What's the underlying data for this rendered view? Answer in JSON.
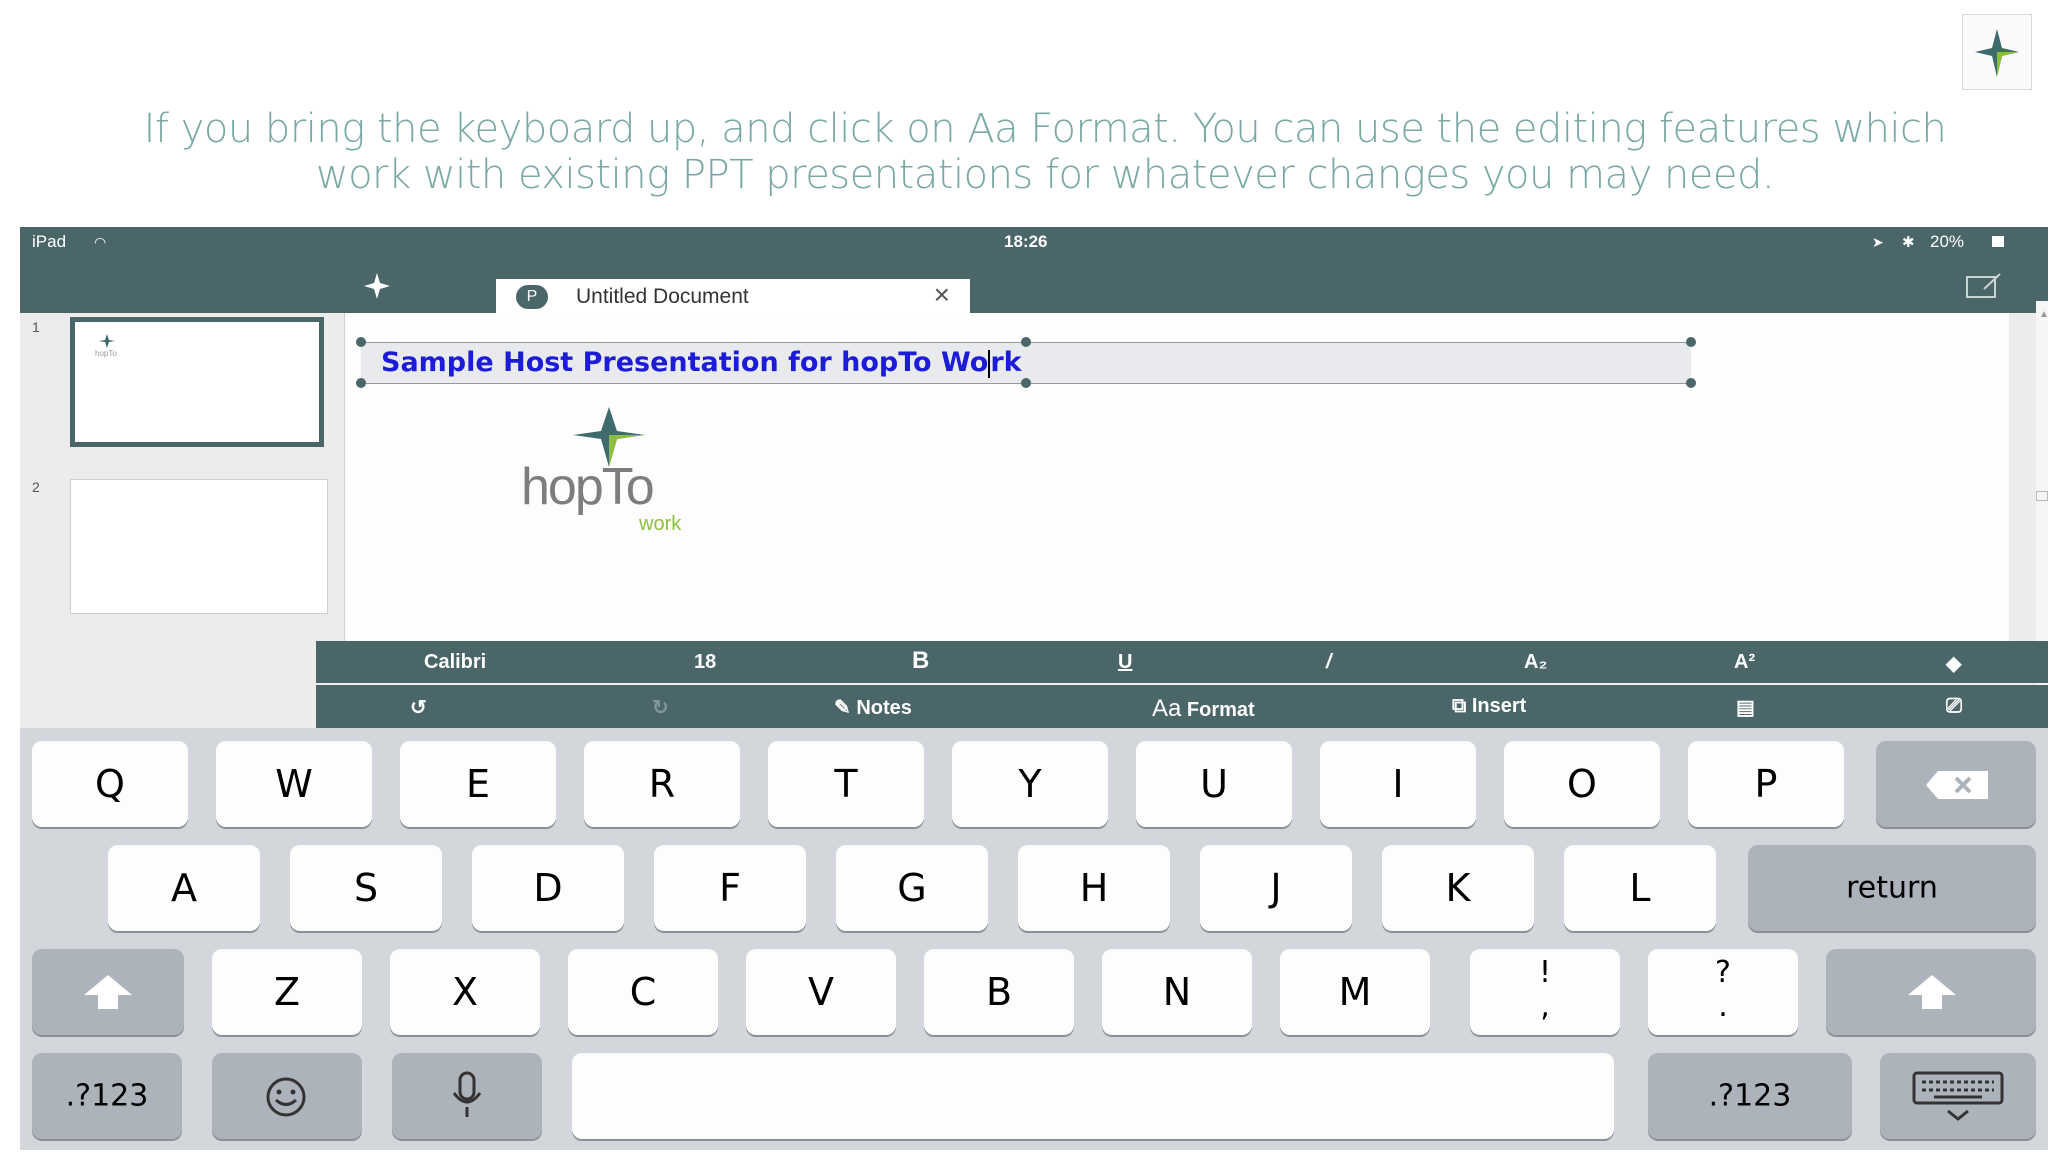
{
  "caption": {
    "line1": "If you bring the keyboard up, and click on Aa Format. You can use the editing features which",
    "line2": "work with existing PPT presentations for whatever changes you may need."
  },
  "status_bar": {
    "device": "iPad",
    "time": "18:26",
    "battery": "20%"
  },
  "document_tab": {
    "badge": "P",
    "title": "Untitled Document"
  },
  "slide_thumbs": [
    {
      "number": "1"
    },
    {
      "number": "2"
    }
  ],
  "slide": {
    "title_before_cursor": "Sample Host Presentation for hopTo Wo",
    "title_after_cursor": "rk",
    "logo": {
      "name": "hopTo",
      "sub": "work"
    }
  },
  "format_bar": {
    "font": "Calibri",
    "size": "18",
    "bold": "B",
    "underline": "U",
    "italic": "/",
    "subscript": "A₂",
    "superscript": "A²"
  },
  "tool_bar": {
    "notes": "Notes",
    "format_prefix": "Aa",
    "format": "Format",
    "insert": "Insert"
  },
  "keyboard": {
    "row1": [
      "Q",
      "W",
      "E",
      "R",
      "T",
      "Y",
      "U",
      "I",
      "O",
      "P"
    ],
    "row2": [
      "A",
      "S",
      "D",
      "F",
      "G",
      "H",
      "J",
      "K",
      "L"
    ],
    "row3": [
      "Z",
      "X",
      "C",
      "V",
      "B",
      "N",
      "M"
    ],
    "punct1": {
      "top": "!",
      "bottom": ","
    },
    "punct2": {
      "top": "?",
      "bottom": "."
    },
    "return": "return",
    "numbers_left": ".?123",
    "numbers_right": ".?123"
  },
  "colors": {
    "bar": "#4a6669",
    "caption": "#7aa9a4",
    "title_text": "#1c1cd8",
    "logo_green": "#8cbf3f",
    "logo_teal": "#3f6b6c"
  }
}
